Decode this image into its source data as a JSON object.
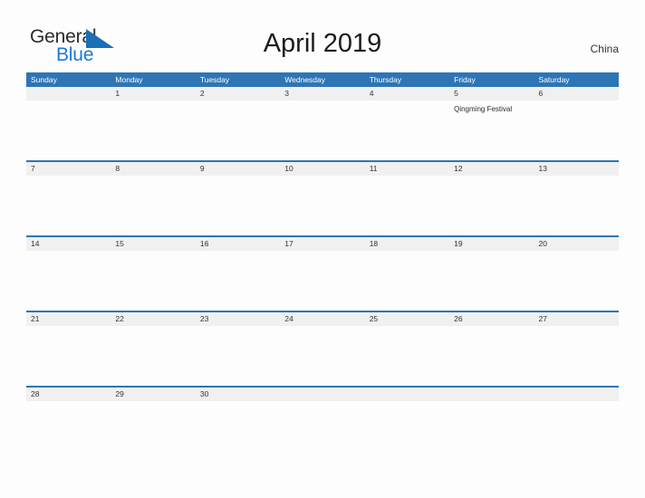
{
  "brand": {
    "name_part1": "General",
    "name_part2": "Blue",
    "triangle_icon": "blue-triangle-icon",
    "accent_color": "#1a7ad4"
  },
  "header": {
    "title": "April 2019",
    "country": "China"
  },
  "theme": {
    "header_blue": "#2e75b6",
    "row_band_gray": "#f0f0f0",
    "page_background": "#fdfdfd",
    "text_color": "#333333"
  },
  "calendar": {
    "weekdays": [
      "Sunday",
      "Monday",
      "Tuesday",
      "Wednesday",
      "Thursday",
      "Friday",
      "Saturday"
    ],
    "weeks": [
      {
        "days": [
          {
            "date": "",
            "event": ""
          },
          {
            "date": "1",
            "event": ""
          },
          {
            "date": "2",
            "event": ""
          },
          {
            "date": "3",
            "event": ""
          },
          {
            "date": "4",
            "event": ""
          },
          {
            "date": "5",
            "event": "Qingming Festival"
          },
          {
            "date": "6",
            "event": ""
          }
        ]
      },
      {
        "days": [
          {
            "date": "7",
            "event": ""
          },
          {
            "date": "8",
            "event": ""
          },
          {
            "date": "9",
            "event": ""
          },
          {
            "date": "10",
            "event": ""
          },
          {
            "date": "11",
            "event": ""
          },
          {
            "date": "12",
            "event": ""
          },
          {
            "date": "13",
            "event": ""
          }
        ]
      },
      {
        "days": [
          {
            "date": "14",
            "event": ""
          },
          {
            "date": "15",
            "event": ""
          },
          {
            "date": "16",
            "event": ""
          },
          {
            "date": "17",
            "event": ""
          },
          {
            "date": "18",
            "event": ""
          },
          {
            "date": "19",
            "event": ""
          },
          {
            "date": "20",
            "event": ""
          }
        ]
      },
      {
        "days": [
          {
            "date": "21",
            "event": ""
          },
          {
            "date": "22",
            "event": ""
          },
          {
            "date": "23",
            "event": ""
          },
          {
            "date": "24",
            "event": ""
          },
          {
            "date": "25",
            "event": ""
          },
          {
            "date": "26",
            "event": ""
          },
          {
            "date": "27",
            "event": ""
          }
        ]
      },
      {
        "days": [
          {
            "date": "28",
            "event": ""
          },
          {
            "date": "29",
            "event": ""
          },
          {
            "date": "30",
            "event": ""
          },
          {
            "date": "",
            "event": ""
          },
          {
            "date": "",
            "event": ""
          },
          {
            "date": "",
            "event": ""
          },
          {
            "date": "",
            "event": ""
          }
        ]
      }
    ]
  }
}
